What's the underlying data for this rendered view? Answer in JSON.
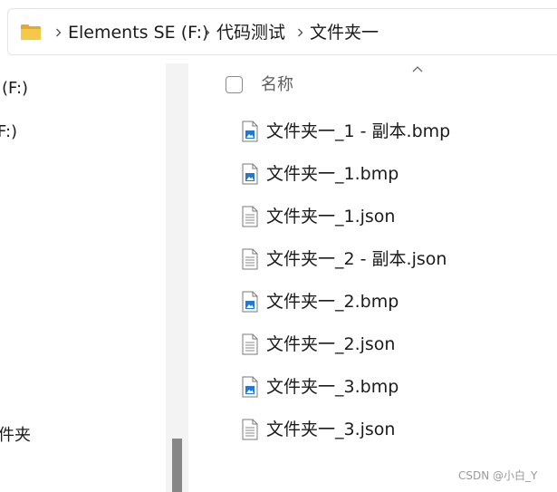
{
  "address_bar": {
    "icon": "folder-icon",
    "crumbs": [
      "Elements SE (F:)",
      "代码测试",
      "文件夹一"
    ],
    "separator_icon": "chevron-right-icon"
  },
  "nav_pane": {
    "items": [
      "(F:)",
      "F:)",
      "件夹"
    ]
  },
  "file_list": {
    "column_header": "名称",
    "sort_indicator": "chevron-up-icon",
    "files": [
      {
        "name": "文件夹一_1 - 副本.bmp",
        "icon": "bmp-image-file-icon"
      },
      {
        "name": "文件夹一_1.bmp",
        "icon": "bmp-image-file-icon"
      },
      {
        "name": "文件夹一_1.json",
        "icon": "text-file-icon"
      },
      {
        "name": "文件夹一_2 - 副本.json",
        "icon": "text-file-icon"
      },
      {
        "name": "文件夹一_2.bmp",
        "icon": "bmp-image-file-icon"
      },
      {
        "name": "文件夹一_2.json",
        "icon": "text-file-icon"
      },
      {
        "name": "文件夹一_3.bmp",
        "icon": "bmp-image-file-icon"
      },
      {
        "name": "文件夹一_3.json",
        "icon": "text-file-icon"
      }
    ]
  },
  "watermark": "CSDN @小白_Y",
  "colors": {
    "folder": "#f4c542",
    "image_icon_accent": "#1e78d4",
    "header_text": "#5f5f5f",
    "scroll_thumb": "#878787"
  }
}
